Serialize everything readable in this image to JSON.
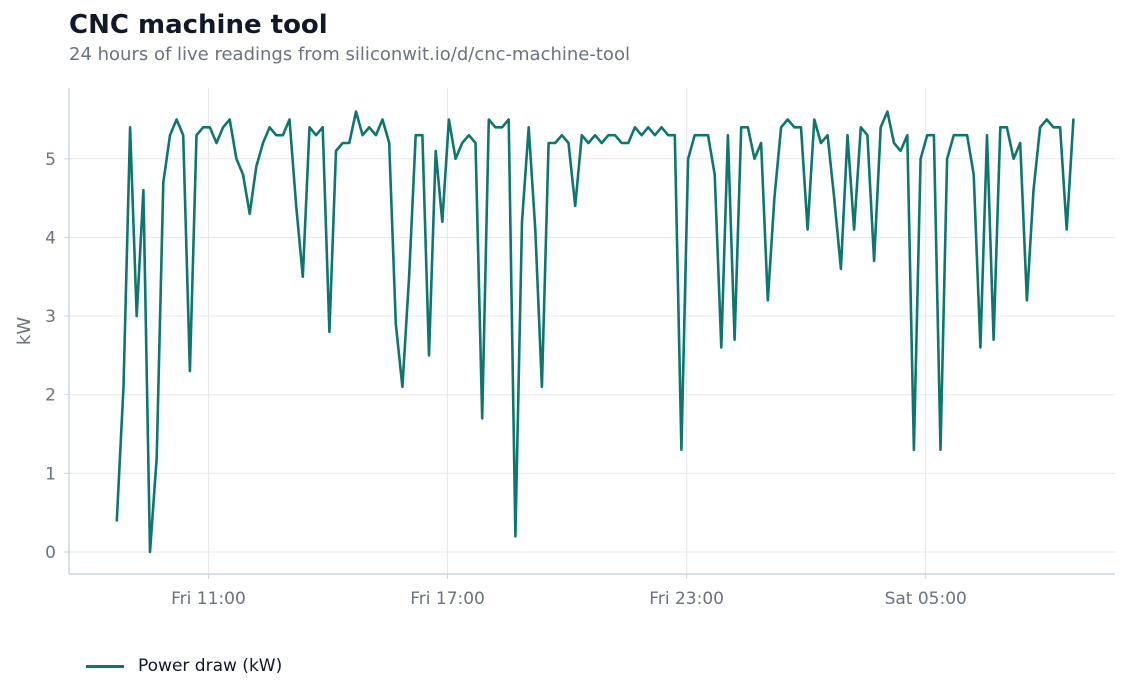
{
  "colors": {
    "series": "#0f766e",
    "grid": "#e5e7eb",
    "axis": "#cbd5e1",
    "text_muted": "#6b7280",
    "text_dark": "#111827"
  },
  "chart_data": {
    "type": "line",
    "title": "CNC machine tool",
    "subtitle": "24 hours of live readings from siliconwit.io/d/cnc-machine-tool",
    "xlabel": "",
    "ylabel": "kW",
    "x_unit": "hours",
    "xlim": [
      7.5,
      33.75
    ],
    "ylim": [
      -0.28,
      5.9
    ],
    "yticks": [
      0,
      1,
      2,
      3,
      4,
      5
    ],
    "xticks": [
      {
        "value": 11,
        "label": "Fri 11:00"
      },
      {
        "value": 17,
        "label": "Fri 17:00"
      },
      {
        "value": 23,
        "label": "Fri 23:00"
      },
      {
        "value": 29,
        "label": "Sat 05:00"
      }
    ],
    "grid": true,
    "legend": "bottom-left",
    "x_start": 8.7,
    "x_step": 0.1667,
    "series": [
      {
        "name": "Power draw (kW)",
        "values": [
          0.4,
          2.1,
          5.4,
          3.0,
          4.6,
          0.0,
          1.2,
          4.7,
          5.3,
          5.5,
          5.3,
          2.3,
          5.3,
          5.4,
          5.4,
          5.2,
          5.4,
          5.5,
          5.0,
          4.8,
          4.3,
          4.9,
          5.2,
          5.4,
          5.3,
          5.3,
          5.5,
          4.4,
          3.5,
          5.4,
          5.3,
          5.4,
          2.8,
          5.1,
          5.2,
          5.2,
          5.6,
          5.3,
          5.4,
          5.3,
          5.5,
          5.2,
          2.9,
          2.1,
          3.5,
          5.3,
          5.3,
          2.5,
          5.1,
          4.2,
          5.5,
          5.0,
          5.2,
          5.3,
          5.2,
          1.7,
          5.5,
          5.4,
          5.4,
          5.5,
          0.2,
          4.2,
          5.4,
          4.1,
          2.1,
          5.2,
          5.2,
          5.3,
          5.2,
          4.4,
          5.3,
          5.2,
          5.3,
          5.2,
          5.3,
          5.3,
          5.2,
          5.2,
          5.4,
          5.3,
          5.4,
          5.3,
          5.4,
          5.3,
          5.3,
          1.3,
          5.0,
          5.3,
          5.3,
          5.3,
          4.8,
          2.6,
          5.3,
          2.7,
          5.4,
          5.4,
          5.0,
          5.2,
          3.2,
          4.5,
          5.4,
          5.5,
          5.4,
          5.4,
          4.1,
          5.5,
          5.2,
          5.3,
          4.5,
          3.6,
          5.3,
          4.1,
          5.4,
          5.3,
          3.7,
          5.4,
          5.6,
          5.2,
          5.1,
          5.3,
          1.3,
          5.0,
          5.3,
          5.3,
          1.3,
          5.0,
          5.3,
          5.3,
          5.3,
          4.8,
          2.6,
          5.3,
          2.7,
          5.4,
          5.4,
          5.0,
          5.2,
          3.2,
          4.6,
          5.4,
          5.5,
          5.4,
          5.4,
          4.1,
          5.5
        ]
      }
    ]
  }
}
